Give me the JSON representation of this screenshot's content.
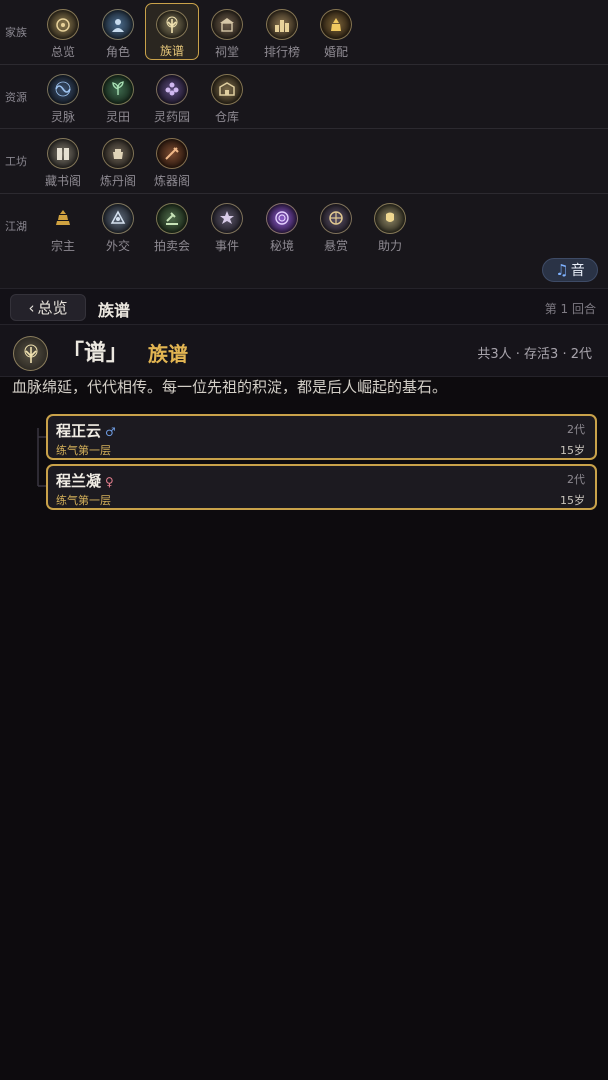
{
  "nav": {
    "rows": [
      {
        "label": "家族",
        "items": [
          {
            "label": "总览",
            "icon": "overview-medal-icon",
            "color": "#8c7a4e"
          },
          {
            "label": "角色",
            "icon": "character-medal-icon",
            "color": "#4a6a8a"
          },
          {
            "label": "族谱",
            "icon": "tree-medal-icon",
            "color": "#7a7256",
            "active": true
          },
          {
            "label": "祠堂",
            "icon": "shrine-medal-icon",
            "color": "#6a5a48"
          },
          {
            "label": "排行榜",
            "icon": "ranking-medal-icon",
            "color": "#8a7450"
          },
          {
            "label": "婚配",
            "icon": "marriage-medal-icon",
            "color": "#7a6238"
          }
        ]
      },
      {
        "label": "资源",
        "items": [
          {
            "label": "灵脉",
            "icon": "spirit-vein-medal-icon",
            "color": "#3a4e6a"
          },
          {
            "label": "灵田",
            "icon": "spirit-field-medal-icon",
            "color": "#3e6a4e"
          },
          {
            "label": "灵药园",
            "icon": "herb-garden-medal-icon",
            "color": "#5a4a7a"
          },
          {
            "label": "仓库",
            "icon": "warehouse-medal-icon",
            "color": "#7a6a4a"
          }
        ]
      },
      {
        "label": "工坊",
        "items": [
          {
            "label": "藏书阁",
            "icon": "library-medal-icon",
            "color": "#7a7468"
          },
          {
            "label": "炼丹阁",
            "icon": "alchemy-medal-icon",
            "color": "#6e6456"
          },
          {
            "label": "炼器阁",
            "icon": "forge-medal-icon",
            "color": "#7a4a30"
          }
        ]
      },
      {
        "label": "江湖",
        "items": [
          {
            "label": "宗主",
            "icon": "sect-master-medal-icon",
            "color": "#7a6230"
          },
          {
            "label": "外交",
            "icon": "diplomacy-medal-icon",
            "color": "#5e6a7a"
          },
          {
            "label": "拍卖会",
            "icon": "auction-medal-icon",
            "color": "#4e6a4a"
          },
          {
            "label": "事件",
            "icon": "event-medal-icon",
            "color": "#5a5468"
          },
          {
            "label": "秘境",
            "icon": "secret-realm-medal-icon",
            "color": "#6a3e9a"
          },
          {
            "label": "悬赏",
            "icon": "bounty-medal-icon",
            "color": "#5a5066"
          },
          {
            "label": "助力",
            "icon": "support-medal-icon",
            "color": "#8a8262"
          }
        ]
      }
    ]
  },
  "music": {
    "icon": "music-note-icon",
    "label": "音"
  },
  "header": {
    "back_label": "总览",
    "title": "族谱",
    "round": "第 1 回合"
  },
  "title_bar": {
    "glyph": "「谱」",
    "name": "族谱",
    "stats": "共3人 · 存活3 · 2代"
  },
  "intro": "血脉绵延，代代相传。每一位先祖的积淀，都是后人崛起的基石。",
  "members": [
    {
      "name": "程正云",
      "gender": "male",
      "gender_symbol": "♂",
      "realm": "练气第一层",
      "generation": "2代",
      "age": "15岁"
    },
    {
      "name": "程兰凝",
      "gender": "female",
      "gender_symbol": "♀",
      "realm": "练气第一层",
      "generation": "2代",
      "age": "15岁"
    }
  ]
}
